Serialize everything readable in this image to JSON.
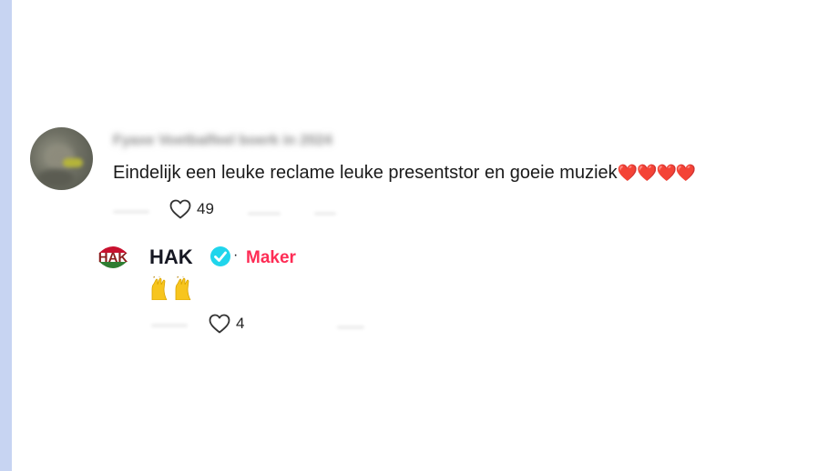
{
  "comment": {
    "username": "Fyaxe Voetbalfeel boerk in 2024",
    "text": "Eindelijk een leuke reclame leuke presentstor en goeie muziek",
    "hearts": "❤️❤️❤️❤️",
    "like_count": "49",
    "heart_icon": "heart-outline-icon"
  },
  "reply": {
    "logo_text": "HAK",
    "author": "HAK",
    "verified_icon": "verified-check-icon",
    "separator": "·",
    "creator_badge": "Maker",
    "emoji_icon": "raising-hands-emoji",
    "like_count": "4",
    "heart_icon": "heart-outline-icon"
  },
  "colors": {
    "accent_maker": "#fe2c55",
    "verified_blue": "#20d5ec",
    "logo_red": "#c8102e",
    "logo_green": "#2f7d32"
  }
}
